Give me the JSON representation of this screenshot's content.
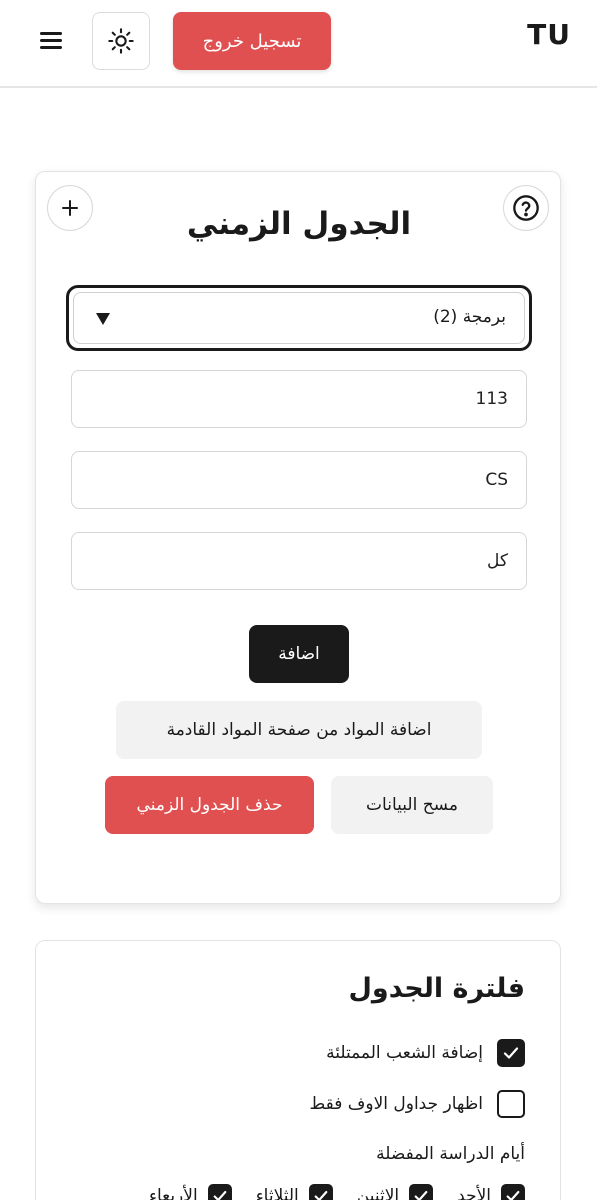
{
  "header": {
    "logo": "TU",
    "logout_label": "تسجيل خروج",
    "theme_icon": "sun-icon",
    "menu_icon": "hamburger-menu-icon"
  },
  "timetable": {
    "title": "الجدول الزمني",
    "add_icon": "plus-icon",
    "help_icon": "question-circle-icon",
    "department_select": {
      "value": "برمجة (2)"
    },
    "course_number": {
      "value": "113"
    },
    "course_code": {
      "value": "CS"
    },
    "section": {
      "value": "كل"
    },
    "add_label": "اضافة",
    "import_label": "اضافة المواد من صفحة المواد القادمة",
    "clear_label": "مسح البيانات",
    "delete_label": "حذف الجدول الزمني"
  },
  "filter": {
    "title": "فلترة الجدول",
    "options": [
      {
        "label": "إضافة الشعب الممتلئة",
        "checked": true
      },
      {
        "label": "اظهار جداول الاوف فقط",
        "checked": false
      }
    ],
    "days_label": "أيام الدراسة المفضلة",
    "days": [
      {
        "label": "الأحد",
        "checked": true
      },
      {
        "label": "الاثنين",
        "checked": true
      },
      {
        "label": "الثلاثاء",
        "checked": true
      },
      {
        "label": "الأربعاء",
        "checked": true
      }
    ]
  },
  "colors": {
    "accent_red": "#e05050",
    "dark": "#1a1a1a",
    "grey_button": "#f2f2f2"
  }
}
